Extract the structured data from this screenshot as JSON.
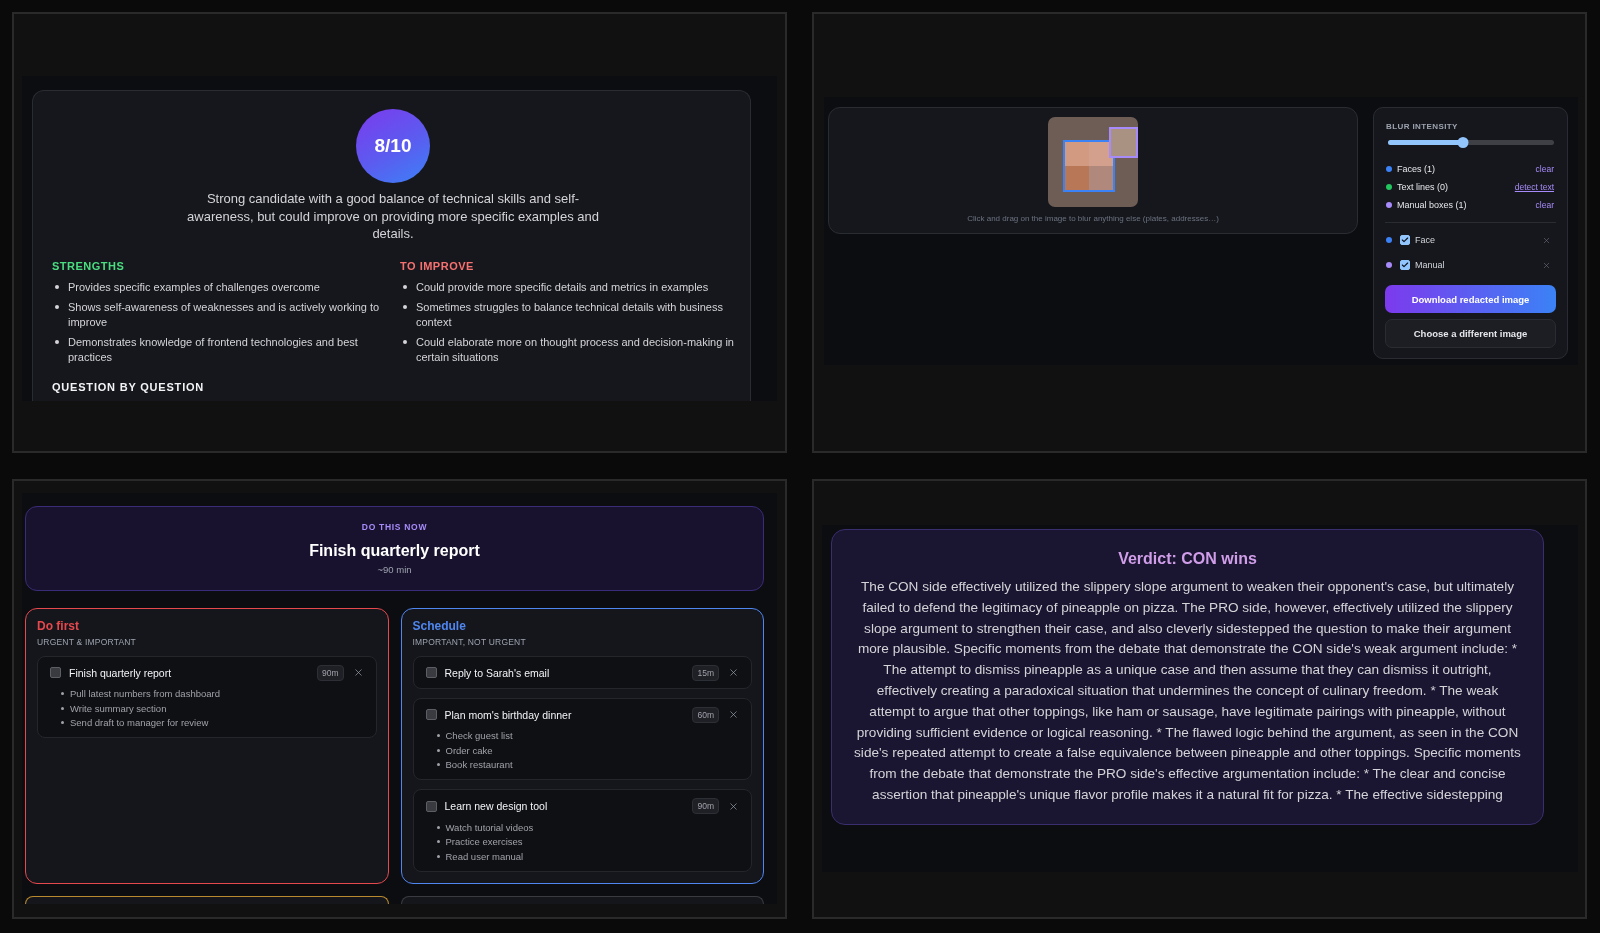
{
  "interview_feedback": {
    "score": "8/10",
    "summary": "Strong candidate with a good balance of technical skills and self-awareness, but could improve on providing more specific examples and details.",
    "sections": [
      {
        "title": "STRENGTHS",
        "color": "#4ade80",
        "items": [
          "Provides specific examples of challenges overcome",
          "Shows self-awareness of weaknesses and is actively working to improve",
          "Demonstrates knowledge of frontend technologies and best practices"
        ]
      },
      {
        "title": "TO IMPROVE",
        "color": "#f87171",
        "items": [
          "Could provide more specific details and metrics in examples",
          "Sometimes struggles to balance technical details with business context",
          "Could elaborate more on thought process and decision-making in certain situations"
        ]
      }
    ],
    "next_heading": "QUESTION BY QUESTION"
  },
  "image_redactor": {
    "caption": "Click and drag on the image to blur anything else (plates, addresses…)",
    "blur_intensity": {
      "label": "BLUR INTENSITY",
      "level": 0.45
    },
    "counts": [
      {
        "label": "Faces (1)",
        "color": "#3b82f6",
        "action": "clear",
        "underlined": false
      },
      {
        "label": "Text lines (0)",
        "color": "#22c55e",
        "action": "detect text",
        "underlined": true
      },
      {
        "label": "Manual boxes (1)",
        "color": "#a78bfa",
        "action": "clear",
        "underlined": false
      }
    ],
    "detections": [
      {
        "kind": "face",
        "label": "Face",
        "checked": true,
        "color": "#3b82f6"
      },
      {
        "kind": "manual",
        "label": "Manual",
        "checked": true,
        "color": "#a78bfa"
      }
    ],
    "buttons": [
      {
        "kind": "primary",
        "label": "Download redacted image"
      },
      {
        "kind": "secondary",
        "label": "Choose a different image"
      }
    ]
  },
  "task_matrix": {
    "focus": {
      "eyebrow": "DO THIS NOW",
      "title": "Finish quarterly report",
      "duration": "~90 min"
    },
    "quadrants": [
      {
        "title": "Do first",
        "subtitle": "URGENT & IMPORTANT",
        "color": "#e5484d",
        "tasks": [
          {
            "title": "Finish quarterly report",
            "checked": false,
            "duration": "90m",
            "subtasks": [
              "Pull latest numbers from dashboard",
              "Write summary section",
              "Send draft to manager for review"
            ]
          }
        ]
      },
      {
        "title": "Schedule",
        "subtitle": "IMPORTANT, NOT URGENT",
        "color": "#4f86f0",
        "tasks": [
          {
            "title": "Reply to Sarah's email",
            "checked": false,
            "duration": "15m"
          },
          {
            "title": "Plan mom's birthday dinner",
            "checked": false,
            "duration": "60m",
            "subtasks": [
              "Check guest list",
              "Order cake",
              "Book restaurant"
            ]
          },
          {
            "title": "Learn new design tool",
            "checked": false,
            "duration": "90m",
            "subtasks": [
              "Watch tutorial videos",
              "Practice exercises",
              "Read user manual"
            ]
          }
        ]
      },
      {
        "color": "#b8892e"
      },
      {
        "color": "#3a3b42"
      }
    ]
  },
  "debate": {
    "verdict_title": "Verdict: CON wins",
    "verdict_body": "The CON side effectively utilized the slippery slope argument to weaken their opponent's case, but ultimately failed to defend the legitimacy of pineapple on pizza. The PRO side, however, effectively utilized the slippery slope argument to strengthen their case, and also cleverly sidestepped the question to make their argument more plausible. Specific moments from the debate that demonstrate the CON side's weak argument include: * The attempt to dismiss pineapple as a unique case and then assume that they can dismiss it outright, effectively creating a paradoxical situation that undermines the concept of culinary freedom. * The weak attempt to argue that other toppings, like ham or sausage, have legitimate pairings with pineapple, without providing sufficient evidence or logical reasoning. * The flawed logic behind the argument, as seen in the CON side's repeated attempt to create a false equivalence between pineapple and other toppings. Specific moments from the debate that demonstrate the PRO side's effective argumentation include: * The clear and concise assertion that pineapple's unique flavor profile makes it a natural fit for pizza. * The effective sidestepping"
  }
}
